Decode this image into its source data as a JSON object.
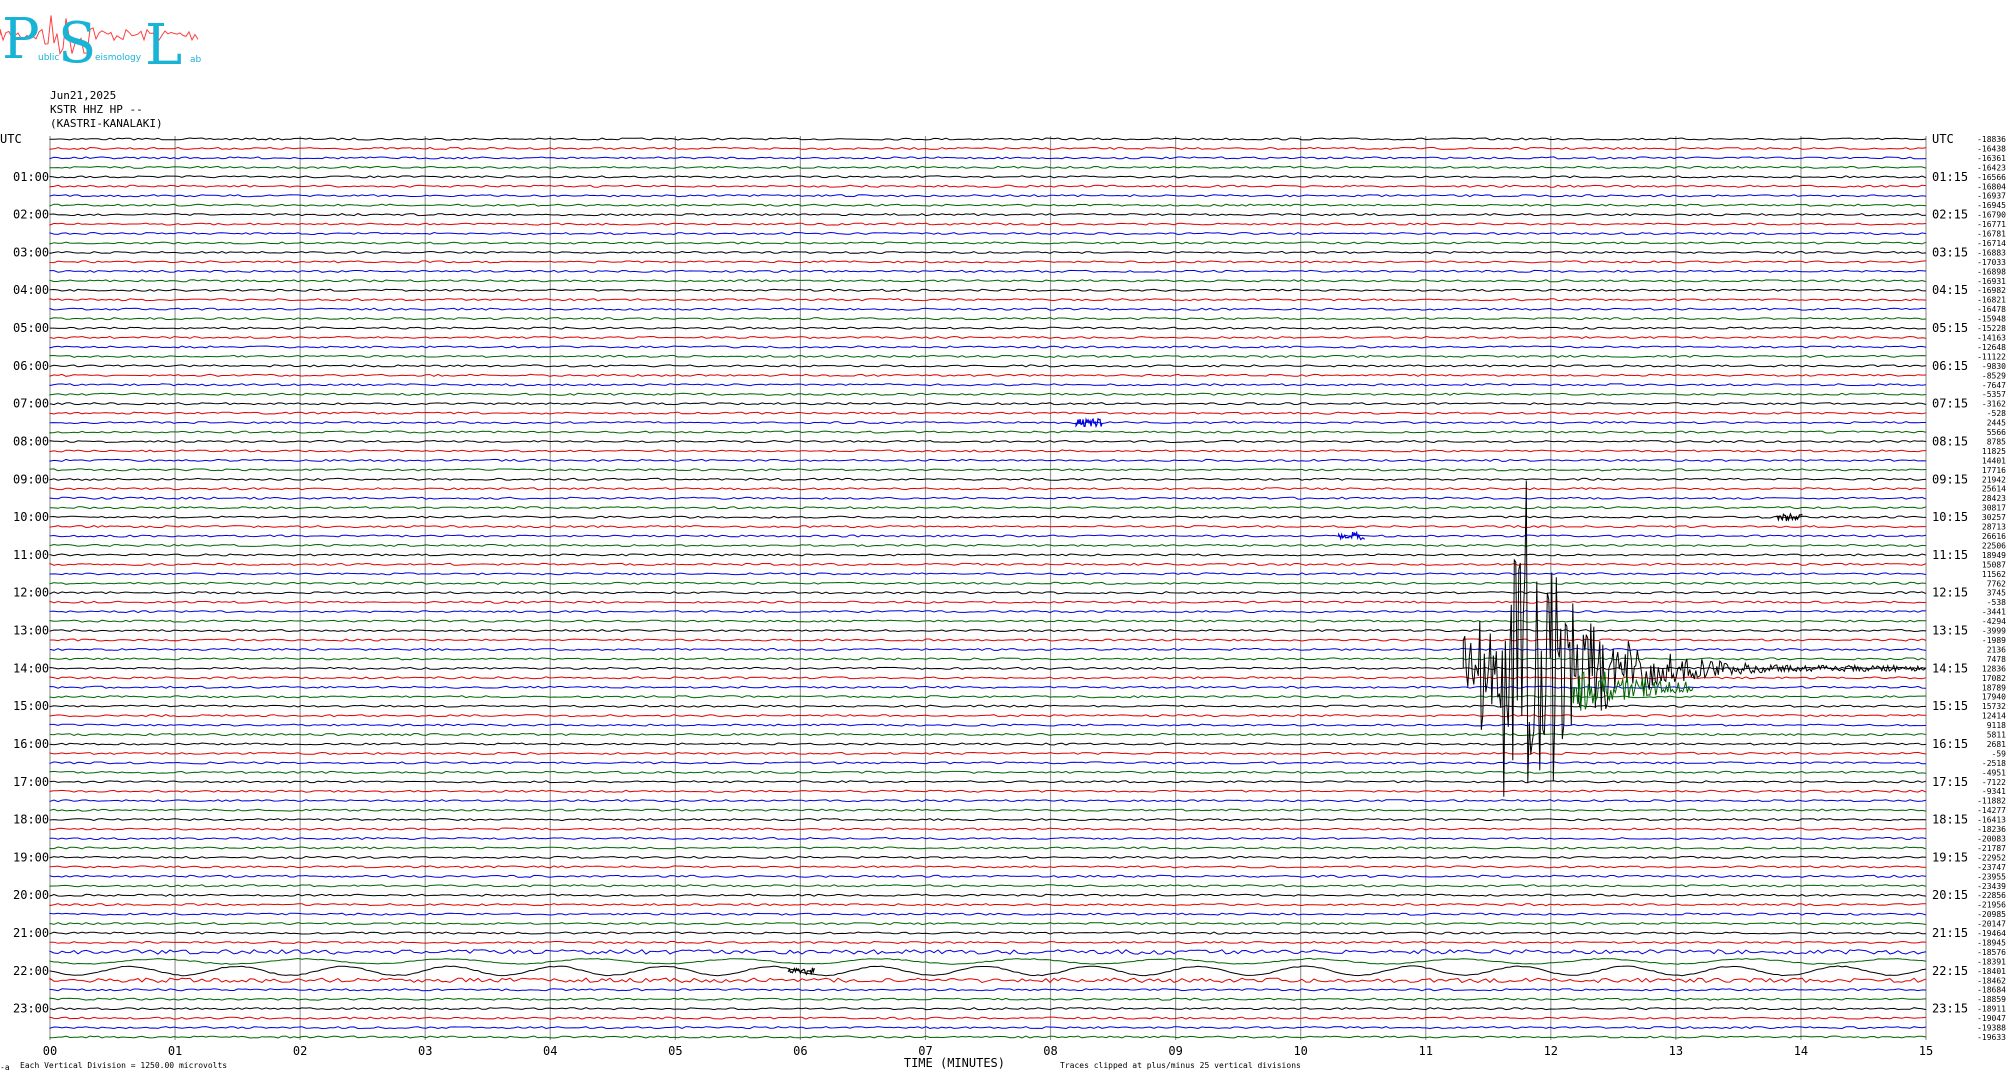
{
  "logo": {
    "letters": [
      "P",
      "S",
      "L"
    ],
    "small_words": [
      "ublic",
      "eismology",
      "ab"
    ]
  },
  "header": {
    "date": "Jun21,2025",
    "channel": "KSTR HHZ HP --",
    "station": "(KASTRI-KANALAKI)"
  },
  "chart_data": {
    "type": "line",
    "title": "",
    "xlabel": "TIME (MINUTES)",
    "ylabel": "UTC",
    "x_ticks": [
      "00",
      "01",
      "02",
      "03",
      "04",
      "05",
      "06",
      "07",
      "08",
      "09",
      "10",
      "11",
      "12",
      "13",
      "14",
      "15"
    ],
    "xlim": [
      0,
      15
    ],
    "left_time_labels": [
      "UTC",
      "01:00",
      "02:00",
      "03:00",
      "04:00",
      "05:00",
      "06:00",
      "07:00",
      "08:00",
      "09:00",
      "10:00",
      "11:00",
      "12:00",
      "13:00",
      "14:00",
      "15:00",
      "16:00",
      "17:00",
      "18:00",
      "19:00",
      "20:00",
      "21:00",
      "22:00",
      "23:00"
    ],
    "right_time_labels": [
      "UTC",
      "01:15",
      "02:15",
      "03:15",
      "04:15",
      "05:15",
      "06:15",
      "07:15",
      "08:15",
      "09:15",
      "10:15",
      "11:15",
      "12:15",
      "13:15",
      "14:15",
      "15:15",
      "16:15",
      "17:15",
      "18:15",
      "19:15",
      "20:15",
      "21:15",
      "22:15",
      "23:15"
    ],
    "trace_colors": [
      "#000000",
      "#e00000",
      "#0000e0",
      "#006400"
    ],
    "trace_offsets": [
      -18836,
      -16438,
      -16361,
      -16423,
      -16566,
      -16804,
      -16937,
      -16945,
      -16790,
      -16771,
      -16781,
      -16714,
      -16883,
      -17033,
      -16898,
      -16931,
      -16982,
      -16821,
      -16478,
      -15948,
      -15228,
      -14163,
      -12648,
      -11122,
      -9830,
      -8529,
      -7647,
      -5357,
      -3162,
      -528,
      2445,
      5566,
      8785,
      11825,
      14401,
      17716,
      21942,
      25614,
      28423,
      30817,
      30257,
      28713,
      26616,
      22506,
      18949,
      15087,
      11562,
      7762,
      3745,
      -538,
      -3441,
      -4294,
      -3999,
      -1989,
      2136,
      7478,
      12836,
      17082,
      18789,
      17940,
      15732,
      12414,
      9118,
      5811,
      2681,
      -59,
      -2518,
      -4951,
      -7122,
      -9341,
      -11882,
      -14277,
      -16413,
      -18236,
      -20083,
      -21787,
      -22952,
      -23747,
      -23955,
      -23439,
      -22856,
      -21956,
      -20985,
      -20147,
      -19464,
      -18945,
      -18576,
      -18391,
      -18401,
      -18462,
      -18684,
      -18859,
      -18911,
      -19047,
      -19388,
      -19633
    ],
    "events": [
      {
        "desc": "major earthquake",
        "trace_index": 56,
        "start_min": 11.3,
        "peak_min": 11.7,
        "end_min": 15.0
      },
      {
        "desc": "small event",
        "trace_index": 30,
        "minute": 8.3
      },
      {
        "desc": "small event",
        "trace_index": 42,
        "minute": 10.4
      },
      {
        "desc": "small event",
        "trace_index": 40,
        "minute": 13.9
      },
      {
        "desc": "small event",
        "trace_index": 88,
        "minute": 6.0
      }
    ],
    "grid": true
  },
  "footer": {
    "left_note": "Each Vertical Division = 1250.00 microvolts",
    "right_note": "Traces clipped at plus/minus 25 vertical divisions",
    "corner_mark": "-a"
  }
}
